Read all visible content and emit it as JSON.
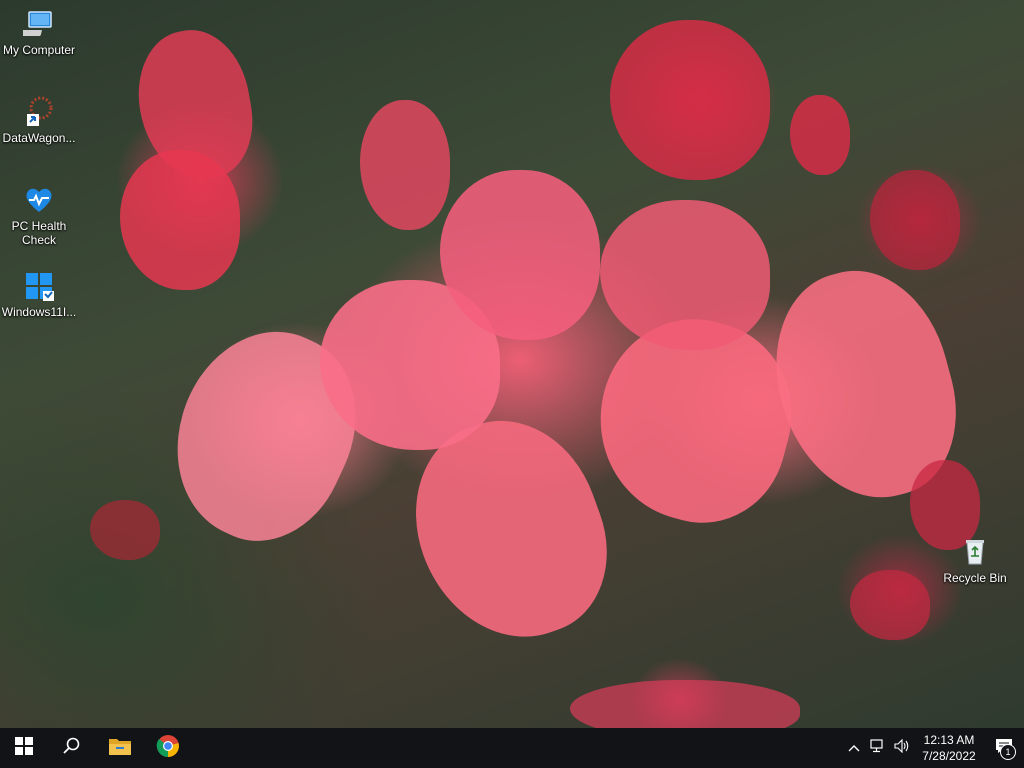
{
  "desktop": {
    "icons": [
      {
        "label": "My Computer",
        "icon": "computer-icon"
      },
      {
        "label": "DataWagon...",
        "icon": "datawagon-icon"
      },
      {
        "label": "PC Health Check",
        "icon": "pc-health-check-icon"
      },
      {
        "label": "Windows11I...",
        "icon": "windows11-installer-icon"
      },
      {
        "label": "Recycle Bin",
        "icon": "recycle-bin-icon"
      }
    ]
  },
  "taskbar": {
    "start": "windows-start-icon",
    "search": "search-icon",
    "pinned": [
      {
        "name": "file-explorer",
        "icon": "folder-icon"
      },
      {
        "name": "chrome",
        "icon": "chrome-icon"
      }
    ],
    "tray": {
      "time": "12:13 AM",
      "date": "7/28/2022",
      "notification_count": "1"
    }
  },
  "colors": {
    "taskbar_bg": "#121316",
    "windows_blue": "#0078d7",
    "folder_yellow": "#f2c14e"
  }
}
